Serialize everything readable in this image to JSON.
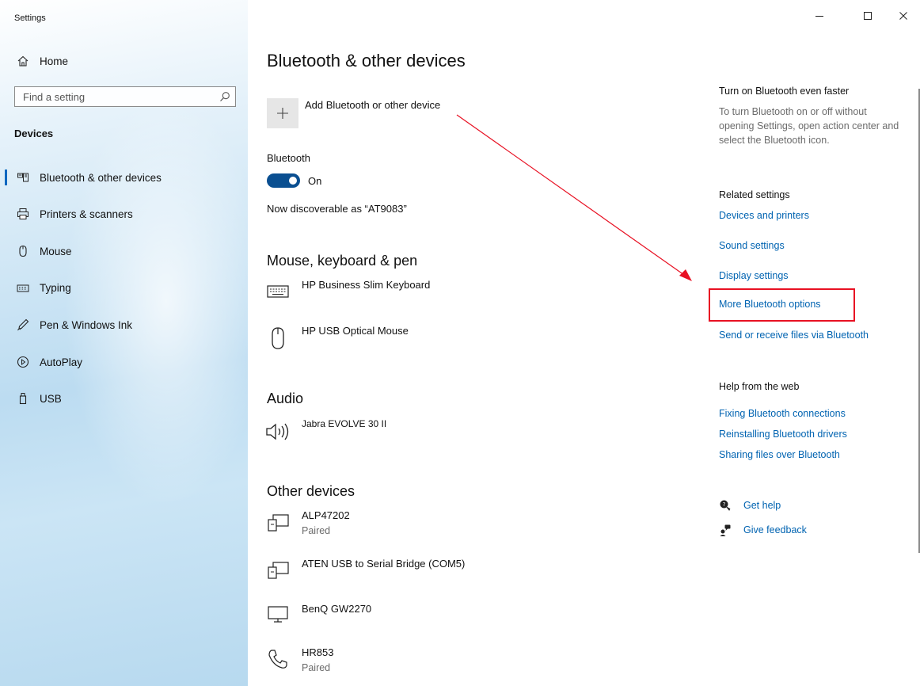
{
  "window": {
    "title": "Settings",
    "controls": {
      "minimize": "—",
      "maximize": "☐",
      "close": "✕"
    }
  },
  "sidebar": {
    "home": "Home",
    "search_placeholder": "Find a setting",
    "section": "Devices",
    "items": [
      {
        "label": "Bluetooth & other devices",
        "icon": "bluetooth-devices-icon",
        "active": true
      },
      {
        "label": "Printers & scanners",
        "icon": "printer-icon"
      },
      {
        "label": "Mouse",
        "icon": "mouse-icon"
      },
      {
        "label": "Typing",
        "icon": "keyboard-icon"
      },
      {
        "label": "Pen & Windows Ink",
        "icon": "pen-icon"
      },
      {
        "label": "AutoPlay",
        "icon": "autoplay-icon"
      },
      {
        "label": "USB",
        "icon": "usb-icon"
      }
    ]
  },
  "main": {
    "title": "Bluetooth & other devices",
    "add_device": "Add Bluetooth or other device",
    "bluetooth_label": "Bluetooth",
    "bluetooth_state": "On",
    "discoverable": "Now discoverable as “AT9083”",
    "sections": {
      "mouse_keyboard": {
        "title": "Mouse, keyboard & pen",
        "devices": [
          {
            "name": "HP Business Slim Keyboard",
            "icon": "keyboard-icon"
          },
          {
            "name": "HP USB Optical Mouse",
            "icon": "mouse-icon"
          }
        ]
      },
      "audio": {
        "title": "Audio",
        "devices": [
          {
            "name": "Jabra EVOLVE 30 II",
            "icon": "speaker-icon"
          }
        ]
      },
      "other": {
        "title": "Other devices",
        "devices": [
          {
            "name": "ALP47202",
            "status": "Paired",
            "icon": "generic-device-icon"
          },
          {
            "name": "ATEN USB to Serial Bridge (COM5)",
            "icon": "generic-device-icon"
          },
          {
            "name": "BenQ GW2270",
            "icon": "monitor-icon"
          },
          {
            "name": "HR853",
            "status": "Paired",
            "icon": "phone-icon"
          }
        ]
      }
    }
  },
  "right": {
    "faster_title": "Turn on Bluetooth even faster",
    "faster_desc": "To turn Bluetooth on or off without opening Settings, open action center and select the Bluetooth icon.",
    "related_title": "Related settings",
    "related": [
      "Devices and printers",
      "Sound settings",
      "Display settings",
      "More Bluetooth options",
      "Send or receive files via Bluetooth"
    ],
    "help_title": "Help from the web",
    "help": [
      "Fixing Bluetooth connections",
      "Reinstalling Bluetooth drivers",
      "Sharing files over Bluetooth"
    ],
    "get_help": "Get help",
    "give_feedback": "Give feedback"
  },
  "colors": {
    "accent": "#0063b1",
    "toggle": "#0a4f91",
    "annotation": "#e81123"
  }
}
